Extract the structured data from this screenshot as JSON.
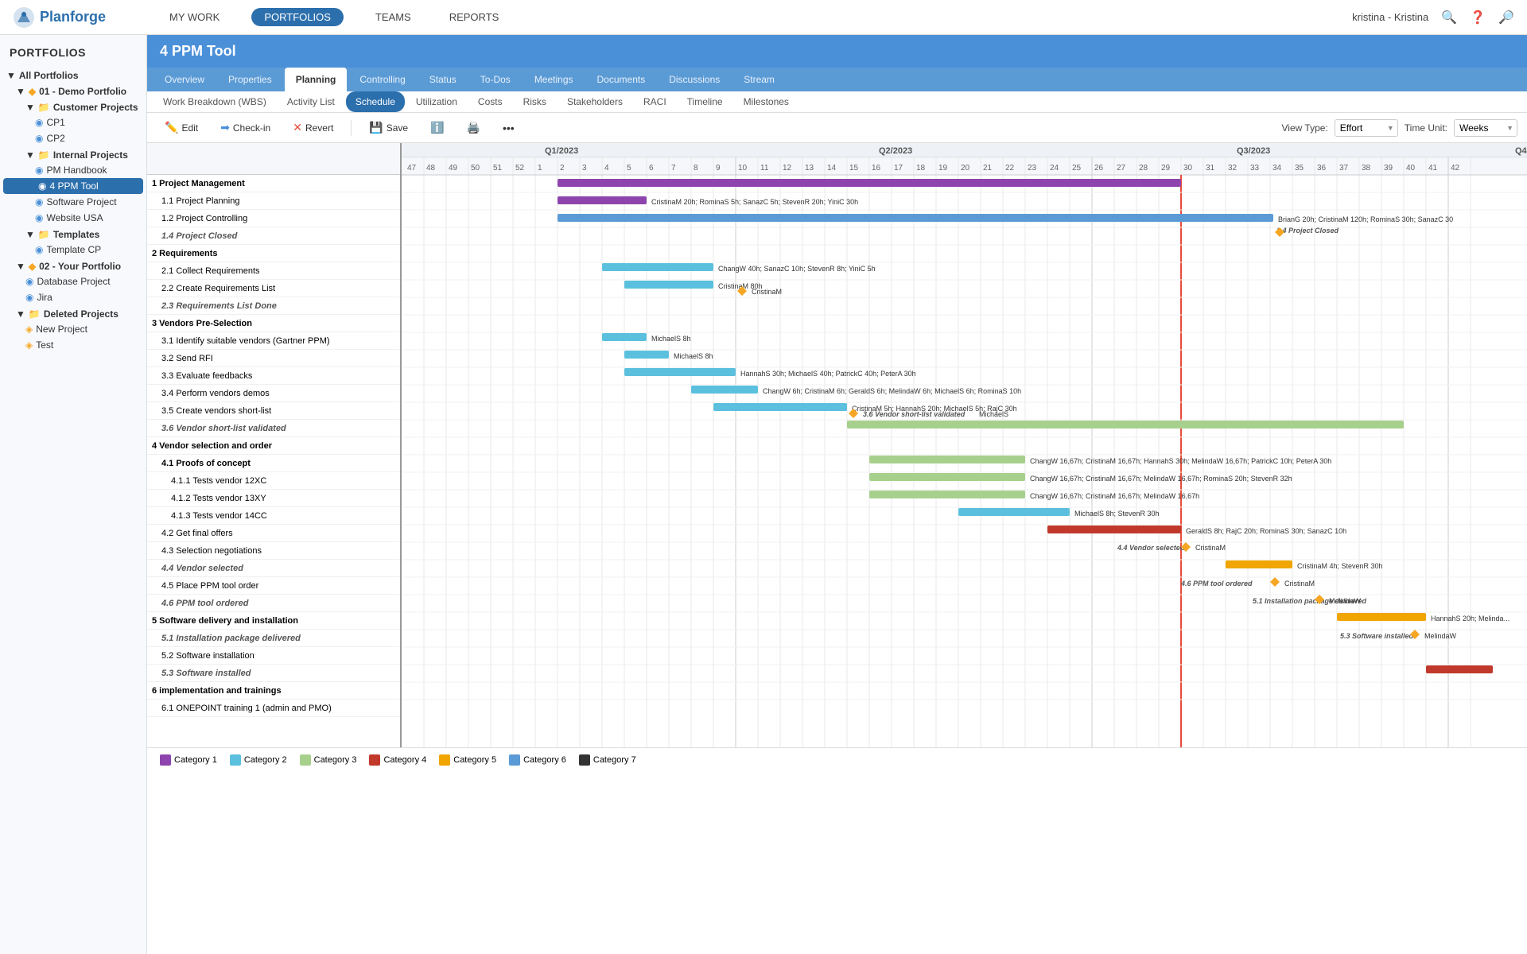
{
  "app": {
    "name": "Planforge",
    "logo_text": "Planforge"
  },
  "top_nav": {
    "items": [
      {
        "label": "MY WORK",
        "active": false
      },
      {
        "label": "PORTFOLIOS",
        "active": true
      },
      {
        "label": "TEAMS",
        "active": false
      },
      {
        "label": "REPORTS",
        "active": false
      }
    ],
    "user": "kristina - Kristina"
  },
  "sidebar": {
    "title": "PORTFOLIOS",
    "groups": [
      {
        "label": "All Portfolios",
        "level": 0,
        "type": "root"
      },
      {
        "label": "01 - Demo Portfolio",
        "level": 1,
        "type": "portfolio"
      },
      {
        "label": "Customer Projects",
        "level": 2,
        "type": "folder"
      },
      {
        "label": "CP1",
        "level": 3,
        "type": "project"
      },
      {
        "label": "CP2",
        "level": 3,
        "type": "project"
      },
      {
        "label": "Internal Projects",
        "level": 2,
        "type": "folder"
      },
      {
        "label": "PM Handbook",
        "level": 3,
        "type": "project"
      },
      {
        "label": "4 PPM Tool",
        "level": 3,
        "type": "project",
        "active": true
      },
      {
        "label": "Software Project",
        "level": 3,
        "type": "project"
      },
      {
        "label": "Website USA",
        "level": 3,
        "type": "project"
      },
      {
        "label": "Templates",
        "level": 2,
        "type": "folder"
      },
      {
        "label": "Template CP",
        "level": 3,
        "type": "project"
      },
      {
        "label": "02 - Your Portfolio",
        "level": 1,
        "type": "portfolio"
      },
      {
        "label": "Database Project",
        "level": 2,
        "type": "project"
      },
      {
        "label": "Jira",
        "level": 2,
        "type": "project"
      },
      {
        "label": "Deleted Projects",
        "level": 1,
        "type": "folder"
      },
      {
        "label": "New Project",
        "level": 2,
        "type": "project"
      },
      {
        "label": "Test",
        "level": 2,
        "type": "project"
      }
    ]
  },
  "project_title": "4 PPM Tool",
  "tabs_row1": [
    {
      "label": "Overview"
    },
    {
      "label": "Properties"
    },
    {
      "label": "Planning",
      "active": true
    },
    {
      "label": "Controlling"
    },
    {
      "label": "Status"
    },
    {
      "label": "To-Dos"
    },
    {
      "label": "Meetings"
    },
    {
      "label": "Documents"
    },
    {
      "label": "Discussions"
    },
    {
      "label": "Stream"
    }
  ],
  "tabs_row2": [
    {
      "label": "Work Breakdown (WBS)"
    },
    {
      "label": "Activity List"
    },
    {
      "label": "Schedule",
      "active": true
    },
    {
      "label": "Utilization"
    },
    {
      "label": "Costs"
    },
    {
      "label": "Risks"
    },
    {
      "label": "Stakeholders"
    },
    {
      "label": "RACI"
    },
    {
      "label": "Timeline"
    },
    {
      "label": "Milestones"
    }
  ],
  "toolbar": {
    "edit": "Edit",
    "checkin": "Check-in",
    "revert": "Revert",
    "save": "Save",
    "view_type_label": "View Type:",
    "view_type_value": "Effort",
    "time_unit_label": "Time Unit:",
    "time_unit_value": "Weeks"
  },
  "gantt": {
    "wbs_rows": [
      {
        "id": "1",
        "label": "1 Project Management",
        "indent": 0,
        "type": "phase"
      },
      {
        "id": "1.1",
        "label": "1.1 Project Planning",
        "indent": 1,
        "type": "task"
      },
      {
        "id": "1.2",
        "label": "1.2 Project Controlling",
        "indent": 1,
        "type": "task"
      },
      {
        "id": "1.4",
        "label": "1.4 Project Closed",
        "indent": 1,
        "type": "milestone"
      },
      {
        "id": "2",
        "label": "2 Requirements",
        "indent": 0,
        "type": "phase"
      },
      {
        "id": "2.1",
        "label": "2.1 Collect Requirements",
        "indent": 1,
        "type": "task"
      },
      {
        "id": "2.2",
        "label": "2.2 Create Requirements List",
        "indent": 1,
        "type": "task"
      },
      {
        "id": "2.3",
        "label": "2.3 Requirements List Done",
        "indent": 1,
        "type": "milestone"
      },
      {
        "id": "3",
        "label": "3 Vendors Pre-Selection",
        "indent": 0,
        "type": "phase"
      },
      {
        "id": "3.1",
        "label": "3.1 Identify suitable vendors (Gartner PPM)",
        "indent": 1,
        "type": "task"
      },
      {
        "id": "3.2",
        "label": "3.2 Send RFI",
        "indent": 1,
        "type": "task"
      },
      {
        "id": "3.3",
        "label": "3.3 Evaluate feedbacks",
        "indent": 1,
        "type": "task"
      },
      {
        "id": "3.4",
        "label": "3.4 Perform vendors demos",
        "indent": 1,
        "type": "task"
      },
      {
        "id": "3.5",
        "label": "3.5 Create vendors short-list",
        "indent": 1,
        "type": "task"
      },
      {
        "id": "3.6",
        "label": "3.6 Vendor short-list validated",
        "indent": 1,
        "type": "milestone"
      },
      {
        "id": "4",
        "label": "4 Vendor selection and order",
        "indent": 0,
        "type": "phase"
      },
      {
        "id": "4.1",
        "label": "4.1 Proofs of concept",
        "indent": 1,
        "type": "phase"
      },
      {
        "id": "4.1.1",
        "label": "4.1.1 Tests vendor 12XC",
        "indent": 2,
        "type": "task"
      },
      {
        "id": "4.1.2",
        "label": "4.1.2 Tests vendor 13XY",
        "indent": 2,
        "type": "task"
      },
      {
        "id": "4.1.3",
        "label": "4.1.3 Tests vendor 14CC",
        "indent": 2,
        "type": "task"
      },
      {
        "id": "4.2",
        "label": "4.2 Get final offers",
        "indent": 1,
        "type": "task"
      },
      {
        "id": "4.3",
        "label": "4.3 Selection negotiations",
        "indent": 1,
        "type": "task"
      },
      {
        "id": "4.4",
        "label": "4.4 Vendor selected",
        "indent": 1,
        "type": "milestone"
      },
      {
        "id": "4.5",
        "label": "4.5 Place PPM tool order",
        "indent": 1,
        "type": "task"
      },
      {
        "id": "4.6",
        "label": "4.6 PPM tool ordered",
        "indent": 1,
        "type": "milestone"
      },
      {
        "id": "5",
        "label": "5 Software delivery and installation",
        "indent": 0,
        "type": "phase"
      },
      {
        "id": "5.1",
        "label": "5.1 Installation package delivered",
        "indent": 1,
        "type": "milestone"
      },
      {
        "id": "5.2",
        "label": "5.2 Software installation",
        "indent": 1,
        "type": "task"
      },
      {
        "id": "5.3",
        "label": "5.3 Software installed",
        "indent": 1,
        "type": "milestone"
      },
      {
        "id": "6",
        "label": "6 implementation and trainings",
        "indent": 0,
        "type": "phase"
      },
      {
        "id": "6.1",
        "label": "6.1 ONEPOINT training 1 (admin and PMO)",
        "indent": 1,
        "type": "task"
      }
    ],
    "categories": [
      {
        "label": "Category 1",
        "color": "#8e44ad"
      },
      {
        "label": "Category 2",
        "color": "#5bc0de"
      },
      {
        "label": "Category 3",
        "color": "#a8d08d"
      },
      {
        "label": "Category 4",
        "color": "#c0392b"
      },
      {
        "label": "Category 5",
        "color": "#f0a500"
      },
      {
        "label": "Category 6",
        "color": "#5b9bd5"
      },
      {
        "label": "Category 7",
        "color": "#333"
      }
    ]
  }
}
